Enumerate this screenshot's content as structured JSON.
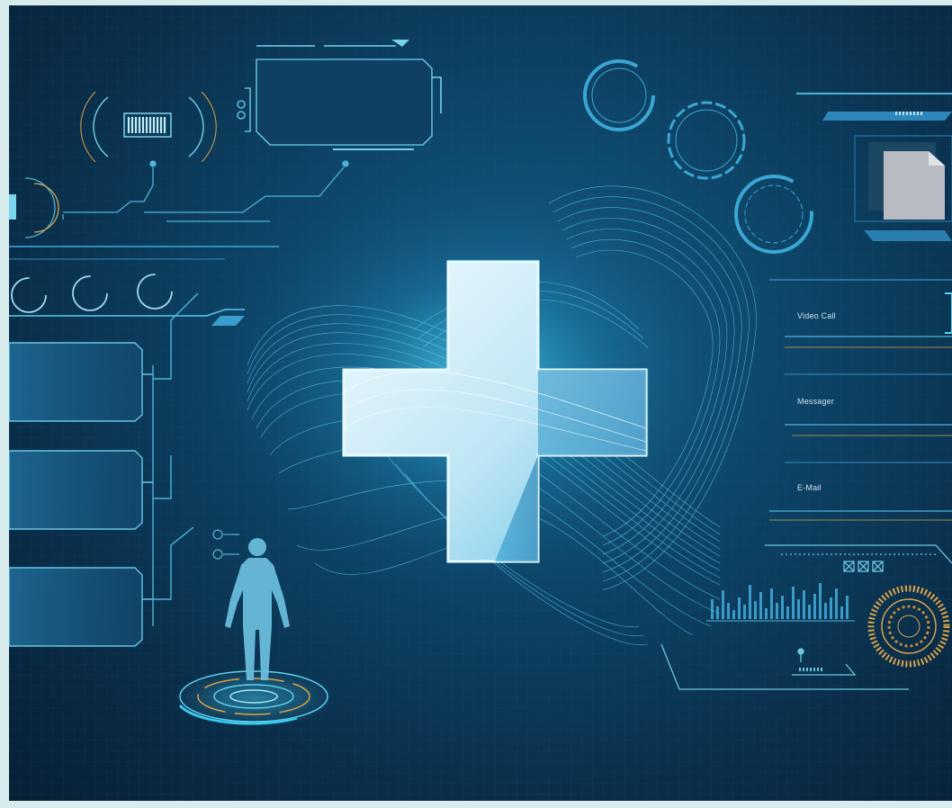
{
  "panel": {
    "fields": [
      {
        "label": "Video Call"
      },
      {
        "label": "Messager"
      },
      {
        "label": "E-Mail"
      }
    ]
  },
  "colors": {
    "background_center": "#145d86",
    "background_edge": "#081f35",
    "hud_cyan": "#4fc8e8",
    "cross_fill": "#dff4fb",
    "cross_glow": "#3fd6ff",
    "accent_orange": "#d8a24a",
    "outer_frame": "#d8ecee"
  },
  "icons": [
    "medical-cross-icon",
    "human-body-icon",
    "dial-icon",
    "document-icon",
    "equalizer-icon"
  ]
}
